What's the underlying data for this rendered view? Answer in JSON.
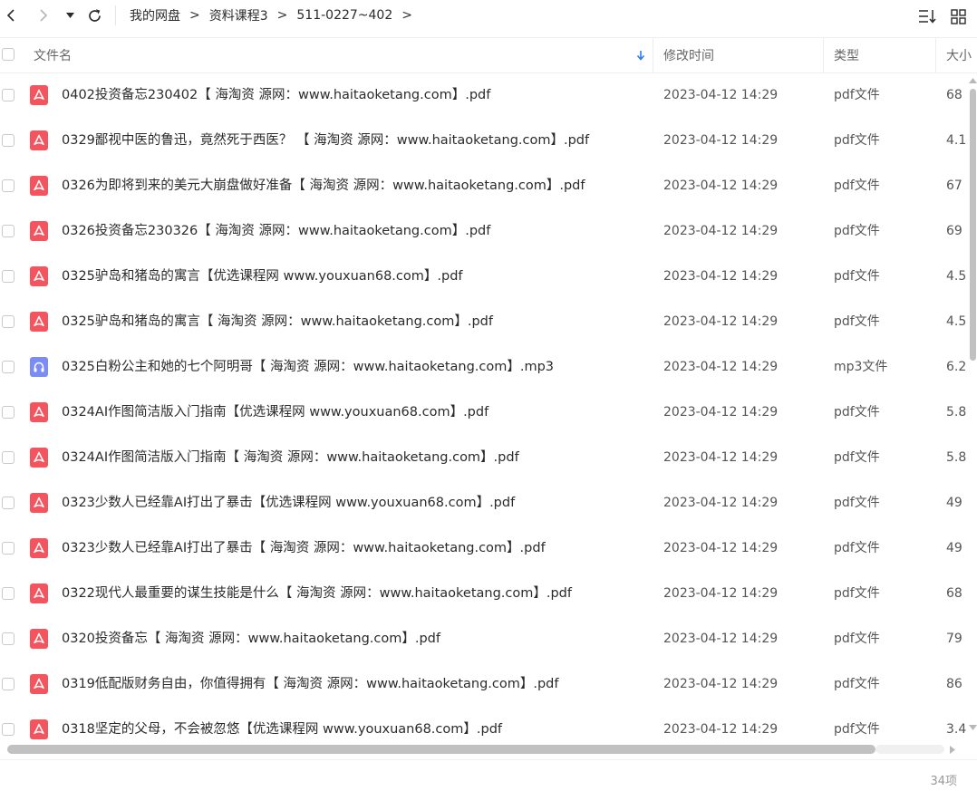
{
  "breadcrumb": {
    "items": [
      "我的网盘",
      "资料课程3",
      "511-0227~402"
    ],
    "separator": ">"
  },
  "columns": {
    "name": "文件名",
    "modified": "修改时间",
    "type": "类型",
    "size": "大小"
  },
  "files": [
    {
      "name": "0402投资备忘230402【 海淘资 源网：www.haitaoketang.com】.pdf",
      "modified": "2023-04-12 14:29",
      "type": "pdf文件",
      "size": "68",
      "icon": "pdf-file-icon"
    },
    {
      "name": "0329鄙视中医的鲁迅，竟然死于西医？ 【 海淘资 源网：www.haitaoketang.com】.pdf",
      "modified": "2023-04-12 14:29",
      "type": "pdf文件",
      "size": "4.1",
      "icon": "pdf-file-icon"
    },
    {
      "name": "0326为即将到来的美元大崩盘做好准备【 海淘资 源网：www.haitaoketang.com】.pdf",
      "modified": "2023-04-12 14:29",
      "type": "pdf文件",
      "size": "67",
      "icon": "pdf-file-icon"
    },
    {
      "name": "0326投资备忘230326【 海淘资 源网：www.haitaoketang.com】.pdf",
      "modified": "2023-04-12 14:29",
      "type": "pdf文件",
      "size": "69",
      "icon": "pdf-file-icon"
    },
    {
      "name": "0325驴岛和猪岛的寓言【优选课程网 www.youxuan68.com】.pdf",
      "modified": "2023-04-12 14:29",
      "type": "pdf文件",
      "size": "4.5",
      "icon": "pdf-file-icon"
    },
    {
      "name": "0325驴岛和猪岛的寓言【 海淘资 源网：www.haitaoketang.com】.pdf",
      "modified": "2023-04-12 14:29",
      "type": "pdf文件",
      "size": "4.5",
      "icon": "pdf-file-icon"
    },
    {
      "name": "0325白粉公主和她的七个阿明哥【 海淘资 源网：www.haitaoketang.com】.mp3",
      "modified": "2023-04-12 14:29",
      "type": "mp3文件",
      "size": "6.2",
      "icon": "audio-file-icon"
    },
    {
      "name": "0324AI作图简洁版入门指南【优选课程网 www.youxuan68.com】.pdf",
      "modified": "2023-04-12 14:29",
      "type": "pdf文件",
      "size": "5.8",
      "icon": "pdf-file-icon"
    },
    {
      "name": "0324AI作图简洁版入门指南【 海淘资 源网：www.haitaoketang.com】.pdf",
      "modified": "2023-04-12 14:29",
      "type": "pdf文件",
      "size": "5.8",
      "icon": "pdf-file-icon"
    },
    {
      "name": "0323少数人已经靠AI打出了暴击【优选课程网 www.youxuan68.com】.pdf",
      "modified": "2023-04-12 14:29",
      "type": "pdf文件",
      "size": "49",
      "icon": "pdf-file-icon"
    },
    {
      "name": "0323少数人已经靠AI打出了暴击【 海淘资 源网：www.haitaoketang.com】.pdf",
      "modified": "2023-04-12 14:29",
      "type": "pdf文件",
      "size": "49",
      "icon": "pdf-file-icon"
    },
    {
      "name": "0322现代人最重要的谋生技能是什么【 海淘资 源网：www.haitaoketang.com】.pdf",
      "modified": "2023-04-12 14:29",
      "type": "pdf文件",
      "size": "68",
      "icon": "pdf-file-icon"
    },
    {
      "name": "0320投资备忘【 海淘资 源网：www.haitaoketang.com】.pdf",
      "modified": "2023-04-12 14:29",
      "type": "pdf文件",
      "size": "79",
      "icon": "pdf-file-icon"
    },
    {
      "name": "0319低配版财务自由，你值得拥有【 海淘资 源网：www.haitaoketang.com】.pdf",
      "modified": "2023-04-12 14:29",
      "type": "pdf文件",
      "size": "86",
      "icon": "pdf-file-icon"
    },
    {
      "name": "0318坚定的父母，不会被忽悠【优选课程网 www.youxuan68.com】.pdf",
      "modified": "2023-04-12 14:29",
      "type": "pdf文件",
      "size": "3.4",
      "icon": "pdf-file-icon"
    }
  ],
  "footer": {
    "count": "34项"
  },
  "colors": {
    "pdf_icon": "#f4545d",
    "audio_icon": "#7b8cf5",
    "sort_arrow": "#2f7cf6"
  }
}
